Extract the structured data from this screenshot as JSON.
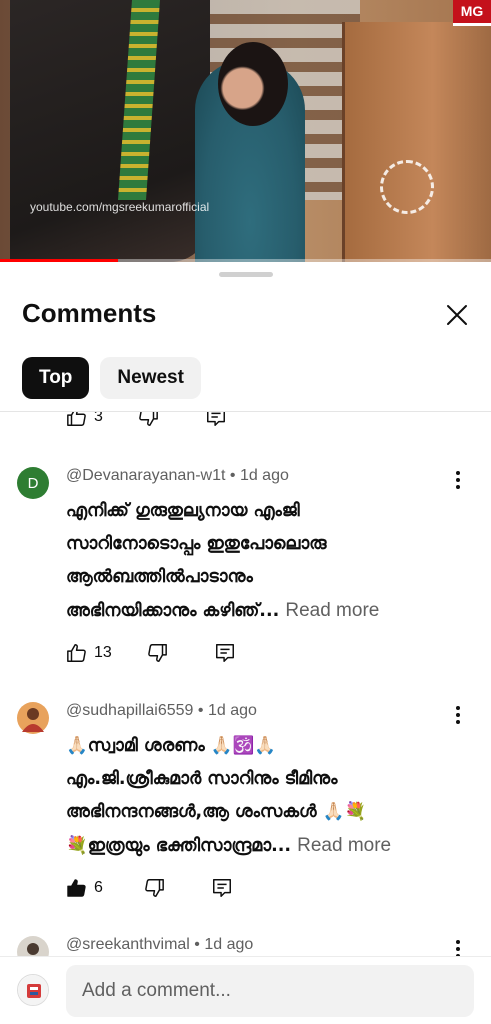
{
  "video": {
    "watermark": "youtube.com/mgsreekumarofficial",
    "logo_text": "MG",
    "progress_fraction": 0.24
  },
  "comments_panel": {
    "title": "Comments",
    "chips": [
      {
        "label": "Top",
        "selected": true
      },
      {
        "label": "Newest",
        "selected": false
      }
    ]
  },
  "previous_comment_actions": {
    "likes": "3"
  },
  "comments": [
    {
      "author": "@Devanarayanan-w1t",
      "time": "1d ago",
      "avatar_letter": "D",
      "avatar_color": "#2e7d32",
      "lines": [
        "എനിക്ക് ഗുരുതുല്യനായ എംജി",
        "സാറിനോടൊപ്പം ഇതുപോലൊരു",
        "ആൽബത്തിൽപാടാനും",
        "അഭിനയിക്കാനും കഴിഞ്..."
      ],
      "read_more": "Read more",
      "likes": "13",
      "liked": false
    },
    {
      "author": "@sudhapillai6559",
      "time": "1d ago",
      "avatar_color": "#d9703a",
      "lines": [
        "🙏🏻സ്വാമി ശരണം 🙏🏻🕉️🙏🏻",
        "എം.ജി.ശ്രീകുമാർ സാറിനും ടീമിനും",
        "അഭിനന്ദനങ്ങൾ,ആ ശംസകൾ 🙏🏻💐",
        "💐ഇത്രയും ഭക്തിസാന്ദ്രമാ..."
      ],
      "read_more": "Read more",
      "likes": "6",
      "liked": true
    },
    {
      "author": "@sreekanthvimal",
      "time": "1d ago",
      "avatar_color": "#4a4a4a"
    }
  ],
  "composer": {
    "placeholder": "Add a comment..."
  },
  "colors": {
    "text_primary": "#0f0f0f",
    "text_secondary": "#606060",
    "chip_active_bg": "#0f0f0f",
    "chip_inactive_bg": "#f1f1f1",
    "progress": "#ff0000"
  },
  "icons": [
    "thumbs-up-icon",
    "thumbs-down-icon",
    "reply-icon",
    "more-vertical-icon",
    "close-icon"
  ]
}
